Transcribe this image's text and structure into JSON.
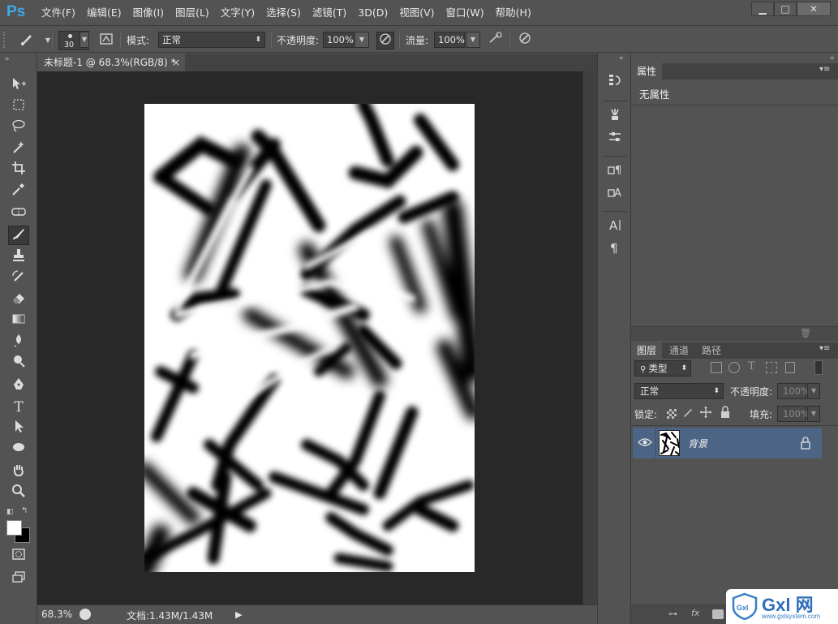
{
  "app": {
    "logo": "Ps",
    "menu": [
      "文件(F)",
      "编辑(E)",
      "图像(I)",
      "图层(L)",
      "文字(Y)",
      "选择(S)",
      "滤镜(T)",
      "3D(D)",
      "视图(V)",
      "窗口(W)",
      "帮助(H)"
    ],
    "window_buttons": [
      "▁",
      "□",
      "✕"
    ]
  },
  "options": {
    "brush_size": "30",
    "mode_label": "模式:",
    "mode_value": "正常",
    "opacity_label": "不透明度:",
    "opacity_value": "100%",
    "flow_label": "流量:",
    "flow_value": "100%"
  },
  "document": {
    "tab_title": "未标题-1 @ 68.3%(RGB/8) *",
    "tab_close": "×",
    "zoom": "68.3%",
    "doc_info": "文档:1.43M/1.43M"
  },
  "tools": [
    "move-tool",
    "marquee-tool",
    "lasso-tool",
    "magic-wand-tool",
    "crop-tool",
    "eyedropper-tool",
    "healing-tool",
    "brush-tool",
    "stamp-tool",
    "history-brush-tool",
    "eraser-tool",
    "gradient-tool",
    "blur-tool",
    "dodge-tool",
    "pen-tool",
    "type-tool",
    "path-select-tool",
    "ellipse-tool",
    "hand-tool",
    "zoom-tool"
  ],
  "properties_panel": {
    "tab": "属性",
    "body_text": "无属性"
  },
  "layers_panel": {
    "tabs": [
      "图层",
      "通道",
      "路径"
    ],
    "filter_label": "类型",
    "blend_mode": "正常",
    "opacity_label": "不透明度:",
    "opacity_value": "100%",
    "lock_label": "锁定:",
    "fill_label": "填充:",
    "fill_value": "100%",
    "layers": [
      {
        "name": "背景",
        "visible": true,
        "locked": true
      }
    ]
  },
  "watermark": {
    "brand": "Gxl 网",
    "url": "www.gxlsystem.com",
    "badge": "Gxl"
  },
  "colors": {
    "ui_bg": "#535353",
    "canvas_bg": "#282828",
    "layer_selected": "#4c6584",
    "logo_blue": "#3fa9e6"
  }
}
